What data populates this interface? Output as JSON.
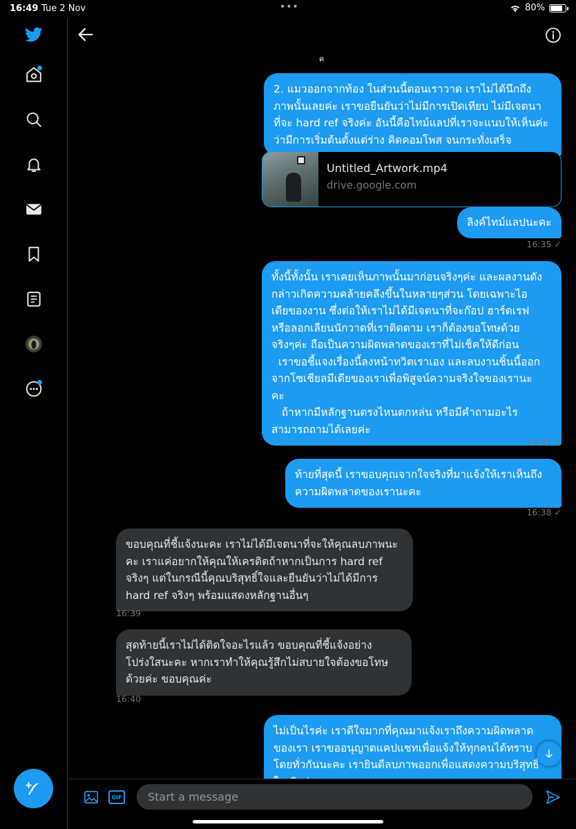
{
  "status_bar": {
    "time": "16:49",
    "date": "Tue 2 Nov",
    "battery": "80%",
    "battery_level": 0.8
  },
  "sidebar": {
    "items": [
      {
        "name": "home"
      },
      {
        "name": "explore"
      },
      {
        "name": "notifications"
      },
      {
        "name": "messages"
      },
      {
        "name": "bookmarks"
      },
      {
        "name": "lists"
      },
      {
        "name": "profile"
      },
      {
        "name": "more"
      }
    ]
  },
  "header": {
    "stray_mark": "ค"
  },
  "messages": [
    {
      "dir": "sent",
      "lines": [
        "2. แมวออกจากท้อง ในส่วนนี้ตอนเราวาด เราไม่ได้นึกถึง",
        "ภาพนั้นเลยค่ะ เราขอยืนยันว่าไม่มีการเปิดเทียบ ไม่มีเจตนา",
        "ที่จะ hard ref จริงค่ะ อันนี้คือไทม์แลปที่เราจะแนบให้เห็นค่ะ",
        "ว่ามีการเริ่มต้นตั้งแต่ร่าง คิดคอมโพส จนกระทั่งเสร็จ"
      ]
    },
    {
      "dir": "sent",
      "lines": [
        "ลิงค์ไทม์แลปนะคะ"
      ],
      "time": "16:35 ✓"
    },
    {
      "dir": "sent",
      "lines": [
        "ทั้งนี้ทั้งนั้น เราเคยเห็นภาพนั้นมาก่อนจริงๆค่ะ และผลงานดัง",
        "กล่าวเกิดความคล้ายคลึงขึ้นในหลายๆส่วน โดยเฉพาะไอ",
        "เดียของงาน ซึ่งต่อให้เราไม่ได้มีเจตนาที่จะก๊อป ฮาร์ดเรฟ",
        "หรือลอกเลียนนักวาดที่เราติดตาม เราก็ต้องขอโทษด้วย",
        "จริงๆค่ะ ถือเป็นความผิดพลาดของเราที่ไม่เช็คให้ดีก่อน",
        "  เราขอชี้แจงเรื่องนี้ลงหน้าทวิตเราเอง และลบงานชิ้นนี้ออก",
        "จากโซเชียลมีเดียของเราเพื่อพิสูจน์ความจริงใจของเรานะ",
        "คะ",
        "   ถ้าหากมีหลักฐานตรงไหนตกหล่น หรือมีคำถามอะไร",
        "สามารถถามได้เลยค่ะ"
      ],
      "time": "16:37 ✓"
    },
    {
      "dir": "sent",
      "lines": [
        "ท้ายที่สุดนี้ เราขอบคุณจากใจจริงที่มาแจ้งให้เราเห็นถึง",
        "ความผิดพลาดของเรานะคะ"
      ],
      "time": "16:38 ✓"
    },
    {
      "dir": "recv",
      "lines": [
        "ขอบคุณที่ชี้แจ้งนะคะ เราไม่ได้มีเจตนาที่จะให้คุณลบภาพนะ",
        "คะ เราแค่อยากให้คุณให้เครดิตถ้าหากเป็นการ hard ref",
        "จริงๆ แต่ในกรณีนี้คุณบริสุทธิ์ใจและยืนยันว่าไม่ได้มีการ",
        "hard ref จริงๆ พร้อมแสดงหลักฐานอื่นๆ"
      ],
      "time": "16:39"
    },
    {
      "dir": "recv",
      "lines": [
        "สุดท้ายนี้เราไม่ได้ติดใจอะไรแล้ว ขอบคุณที่ชี้แจ้งอย่าง",
        "โปร่งใสนะคะ หากเราทำให้คุณรู้สึกไม่สบายใจต้องขอโทษ",
        "ด้วยค่ะ ขอบคุณค่ะ"
      ],
      "time": "16:40"
    },
    {
      "dir": "sent",
      "lines": [
        "ไม่เป็นไรค่ะ เราดีใจมากที่คุณมาแจ้งเราถึงความผิดพลาด",
        "ของเรา เราขออนุญาตแคปแชทเพื่อแจ้งให้ทุกคนได้ทราบ",
        "โดยทั่วกันนะคะ เรายินดีลบภาพออกเพื่อแสดงความบริสุทธิ์",
        "ใจจริงค่ะ"
      ]
    }
  ],
  "link_card": {
    "title": "Untitled_Artwork.mp4",
    "domain": "drive.google.com"
  },
  "composer": {
    "placeholder": "Start a message",
    "gif_label": "GIF"
  },
  "colors": {
    "accent": "#1d9bf0",
    "received_bubble": "#2f3336",
    "background": "#000000"
  }
}
